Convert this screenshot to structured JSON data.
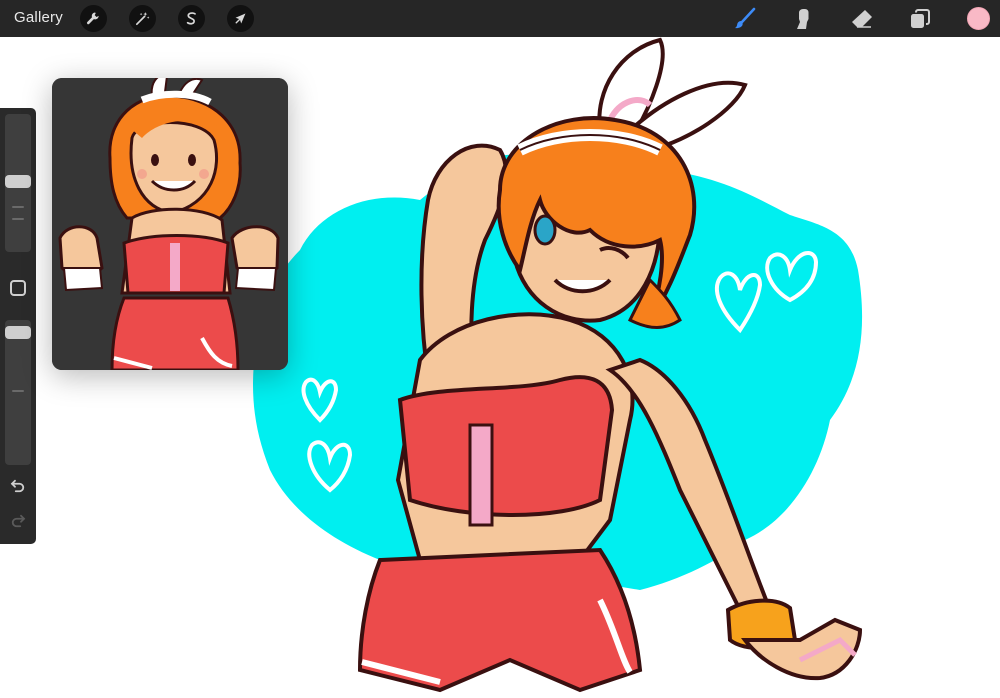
{
  "toolbar": {
    "gallery_label": "Gallery",
    "left_tools": [
      {
        "name": "actions",
        "icon": "wrench-icon"
      },
      {
        "name": "adjustments",
        "icon": "magic-wand-icon"
      },
      {
        "name": "selection",
        "icon": "selection-s-icon"
      },
      {
        "name": "transform",
        "icon": "arrow-cursor-icon"
      }
    ],
    "right_tools": [
      {
        "name": "brush",
        "icon": "brush-icon",
        "active": true
      },
      {
        "name": "smudge",
        "icon": "smudge-icon"
      },
      {
        "name": "eraser",
        "icon": "eraser-icon"
      },
      {
        "name": "layers",
        "icon": "layers-icon"
      }
    ],
    "current_color": "#f9b9c6",
    "active_tool_color": "#3d8bf7"
  },
  "sidebar": {
    "brush_size_level": 0.5,
    "opacity_level": 0.05
  },
  "colors": {
    "background_blob": "#00eff0",
    "hair": "#f7801c",
    "skin": "#f5c79c",
    "outfit": "#ec4b4b",
    "outline": "#3a1010",
    "reference_bg": "#363636"
  }
}
